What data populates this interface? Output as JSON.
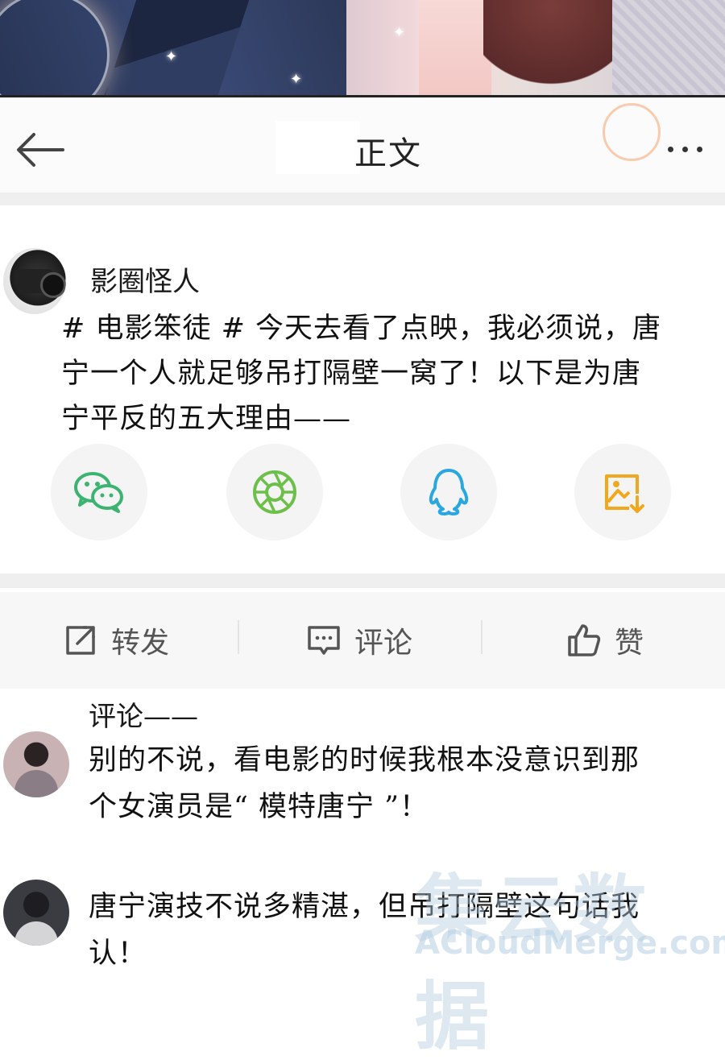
{
  "header": {
    "title": "正文",
    "back_icon": "arrow-left-icon",
    "more_icon": "more-dots-icon"
  },
  "post": {
    "author": "影圈怪人",
    "text_lines": [
      "# 电影笨徒 # 今天去看了点映，我必须说，唐",
      "宁一个人就足够吊打隔壁一窝了！以下是为唐",
      "宁平反的五大理由——"
    ],
    "share_icons": [
      "wechat-icon",
      "moments-icon",
      "qq-icon",
      "save-image-icon"
    ]
  },
  "actions": {
    "repost": "转发",
    "comment": "评论",
    "like": "赞"
  },
  "comments": {
    "heading": "评论——",
    "items": [
      {
        "lines": [
          "别的不说，看电影的时候我根本没意识到那",
          "个女演员是“ 模特唐宁 ”！"
        ]
      },
      {
        "lines": [
          "唐宁演技不说多精湛，但吊打隔壁这句话我",
          "认！"
        ]
      }
    ]
  },
  "watermark": {
    "chinese": "集云数据",
    "english": "ACloudMerge.com"
  },
  "colors": {
    "wechat": "#3cb371",
    "moments": "#6cc04a",
    "qq": "#2aa6e0",
    "save": "#f2a81d",
    "icon_gray": "#555555"
  }
}
